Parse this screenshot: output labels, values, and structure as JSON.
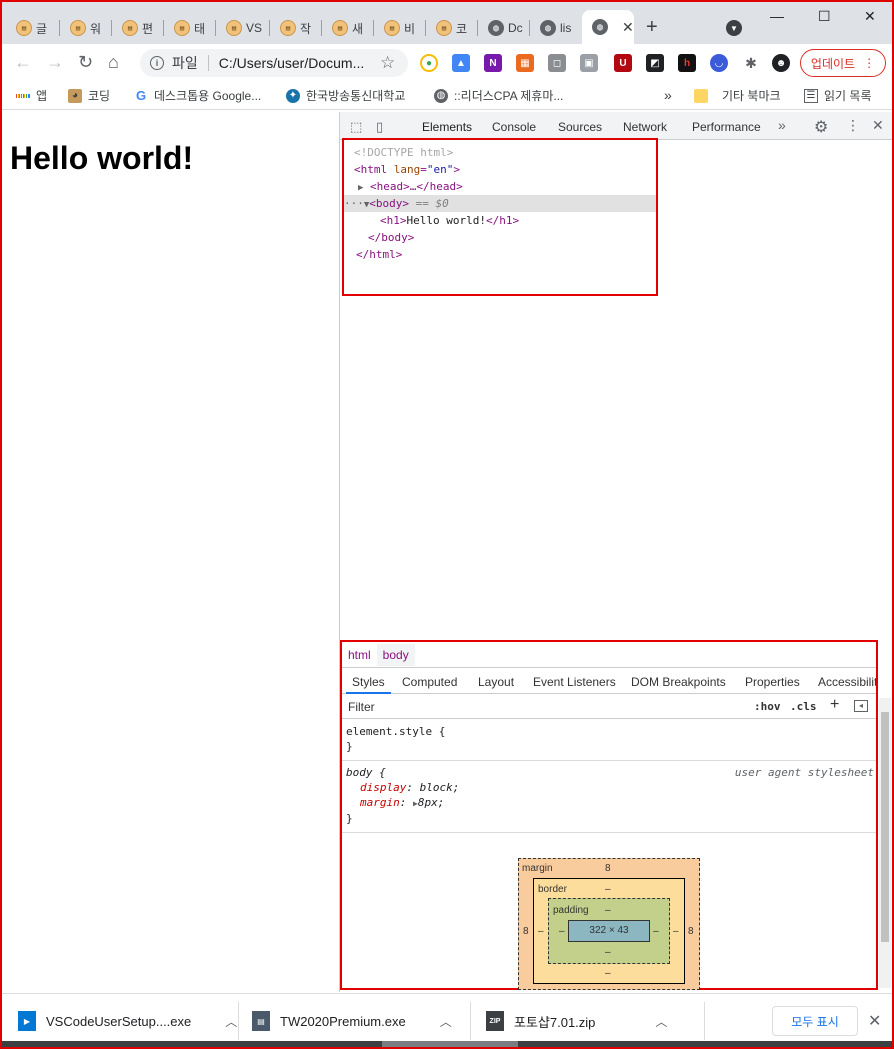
{
  "tabs": [
    {
      "label": "글",
      "icon": "notebook"
    },
    {
      "label": "워",
      "icon": "notebook"
    },
    {
      "label": "편",
      "icon": "notebook"
    },
    {
      "label": "태",
      "icon": "notebook"
    },
    {
      "label": "VS",
      "icon": "notebook"
    },
    {
      "label": "작",
      "icon": "notebook"
    },
    {
      "label": "새",
      "icon": "notebook"
    },
    {
      "label": "비",
      "icon": "notebook"
    },
    {
      "label": "코",
      "icon": "notebook"
    },
    {
      "label": "Dc",
      "icon": "globe"
    },
    {
      "label": "lis",
      "icon": "globe"
    }
  ],
  "window_controls": {
    "minimize": "—",
    "maximize": "☐",
    "close": "✕"
  },
  "toolbar": {
    "scheme_label": "파일",
    "url": "C:/Users/user/Docum...",
    "update_label": "업데이트"
  },
  "bookmarks": [
    {
      "label": "앱"
    },
    {
      "label": "코딩"
    },
    {
      "label": "데스크톱용 Google..."
    },
    {
      "label": "한국방송통신대학교"
    },
    {
      "label": "::리더스CPA 제휴마..."
    }
  ],
  "bookmarks_more": "»",
  "bookmarks_other": "기타 북마크",
  "bookmarks_reading": "읽기 목록",
  "page": {
    "heading": "Hello world!"
  },
  "devtools": {
    "tabs": [
      "Elements",
      "Console",
      "Sources",
      "Network",
      "Performance"
    ],
    "more": "»",
    "dom": {
      "doctype": "<!DOCTYPE html>",
      "html_open_tag": "<html",
      "html_attr_name": " lang",
      "html_attr_eq": "=",
      "html_attr_value": "\"en\"",
      "html_open_close": ">",
      "head": "<head>…</head>",
      "body_open": "<body>",
      "selected_marker": " == $0",
      "h1_open": "<h1>",
      "h1_text": "Hello world!",
      "h1_close": "</h1>",
      "body_close": "</body>",
      "html_close": "</html>"
    },
    "breadcrumbs": [
      "html",
      "body"
    ],
    "subtabs": [
      "Styles",
      "Computed",
      "Layout",
      "Event Listeners",
      "DOM Breakpoints",
      "Properties",
      "Accessibility"
    ],
    "filter_placeholder": "Filter",
    "hov": ":hov",
    "cls": ".cls",
    "rules": {
      "element_style_open": "element.style {",
      "element_style_close": "}",
      "body_selector": "body {",
      "body_source": "user agent stylesheet",
      "display_name": "display",
      "display_value": "block;",
      "margin_name": "margin",
      "margin_value": "8px;",
      "body_close": "}"
    },
    "box_model": {
      "margin_label": "margin",
      "margin_top": "8",
      "margin_left": "8",
      "margin_right": "8",
      "border_label": "border",
      "border_value": "–",
      "padding_label": "padding",
      "padding_value": "–",
      "content_size": "322 × 43"
    }
  },
  "downloads": [
    {
      "name": "VSCodeUserSetup....exe"
    },
    {
      "name": "TW2020Premium.exe"
    },
    {
      "name": "포토샵7.01.zip"
    }
  ],
  "show_all": "모두 표시"
}
